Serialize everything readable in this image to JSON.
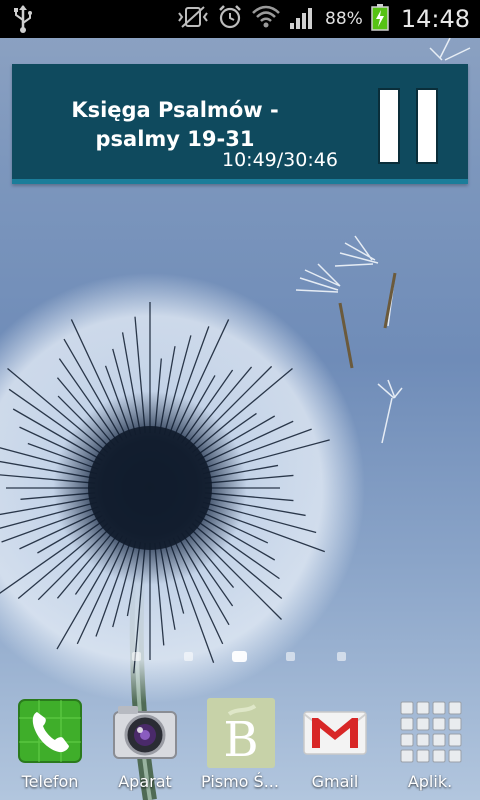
{
  "status_bar": {
    "battery_percent": "88%",
    "clock": "14:48",
    "icons": [
      "usb-icon",
      "vibrate-icon",
      "alarm-icon",
      "wifi-icon",
      "signal-icon",
      "battery-charging-icon"
    ]
  },
  "widget": {
    "title": "Księga Psalmów - psalmy 19-31",
    "time": "10:49/30:46",
    "control_icon": "pause-icon",
    "background_color": "#0f4a5e",
    "accent_color": "#1b7d9a"
  },
  "home": {
    "page_count": 5,
    "current_page": 3
  },
  "dock": {
    "items": [
      {
        "label": "Telefon",
        "icon": "phone-icon"
      },
      {
        "label": "Aparat",
        "icon": "camera-icon"
      },
      {
        "label": "Pismo Ś...",
        "icon": "bible-app-icon",
        "letter": "B"
      },
      {
        "label": "Gmail",
        "icon": "gmail-icon"
      },
      {
        "label": "Aplik.",
        "icon": "apps-grid-icon"
      }
    ]
  }
}
